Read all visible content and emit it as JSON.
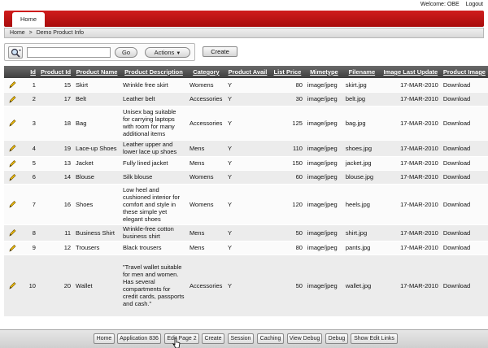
{
  "header": {
    "welcome": "Welcome: OBE",
    "logout": "Logout"
  },
  "tabs": [
    {
      "label": "Home"
    }
  ],
  "breadcrumb": {
    "home": "Home",
    "separator": ">",
    "current": "Demo Product Info"
  },
  "search": {
    "value": "",
    "go_label": "Go",
    "actions_label": "Actions",
    "actions_icon": "caret-down-icon"
  },
  "create_label": "Create",
  "table": {
    "columns": [
      "",
      "Id",
      "Product Id",
      "Product Name",
      "Product Description",
      "Category",
      "Product Avail",
      "List Price",
      "Mimetype",
      "Filename",
      "Image Last Update",
      "Product Image"
    ],
    "rows": [
      {
        "id": "1",
        "product_id": "15",
        "name": "Skirt",
        "description": "Wrinkle free skirt",
        "category": "Womens",
        "avail": "Y",
        "price": "80",
        "mimetype": "image/jpeg",
        "filename": "skirt.jpg",
        "updated": "17-MAR-2010",
        "image": "Download"
      },
      {
        "id": "2",
        "product_id": "17",
        "name": "Belt",
        "description": "Leather belt",
        "category": "Accessories",
        "avail": "Y",
        "price": "30",
        "mimetype": "image/jpeg",
        "filename": "belt.jpg",
        "updated": "17-MAR-2010",
        "image": "Download"
      },
      {
        "id": "3",
        "product_id": "18",
        "name": "Bag",
        "description": "Unisex bag suitable for carrying laptops with room for many additional items",
        "category": "Accessories",
        "avail": "Y",
        "price": "125",
        "mimetype": "image/jpeg",
        "filename": "bag.jpg",
        "updated": "17-MAR-2010",
        "image": "Download"
      },
      {
        "id": "4",
        "product_id": "19",
        "name": "Lace-up Shoes",
        "description": "Leather upper and lower lace up shoes",
        "category": "Mens",
        "avail": "Y",
        "price": "110",
        "mimetype": "image/jpeg",
        "filename": "shoes.jpg",
        "updated": "17-MAR-2010",
        "image": "Download"
      },
      {
        "id": "5",
        "product_id": "13",
        "name": "Jacket",
        "description": "Fully lined jacket",
        "category": "Mens",
        "avail": "Y",
        "price": "150",
        "mimetype": "image/jpeg",
        "filename": "jacket.jpg",
        "updated": "17-MAR-2010",
        "image": "Download"
      },
      {
        "id": "6",
        "product_id": "14",
        "name": "Blouse",
        "description": "Silk blouse",
        "category": "Womens",
        "avail": "Y",
        "price": "60",
        "mimetype": "image/jpeg",
        "filename": "blouse.jpg",
        "updated": "17-MAR-2010",
        "image": "Download"
      },
      {
        "id": "7",
        "product_id": "16",
        "name": "Shoes",
        "description": "Low heel and cushioned interior for comfort and style in these simple yet elegant shoes",
        "category": "Womens",
        "avail": "Y",
        "price": "120",
        "mimetype": "image/jpeg",
        "filename": "heels.jpg",
        "updated": "17-MAR-2010",
        "image": "Download"
      },
      {
        "id": "8",
        "product_id": "11",
        "name": "Business Shirt",
        "description": "Wrinkle-free cotton business shirt",
        "category": "Mens",
        "avail": "Y",
        "price": "50",
        "mimetype": "image/jpeg",
        "filename": "shirt.jpg",
        "updated": "17-MAR-2010",
        "image": "Download"
      },
      {
        "id": "9",
        "product_id": "12",
        "name": "Trousers",
        "description": "Black trousers",
        "category": "Mens",
        "avail": "Y",
        "price": "80",
        "mimetype": "image/jpeg",
        "filename": "pants.jpg",
        "updated": "17-MAR-2010",
        "image": "Download"
      },
      {
        "id": "10",
        "product_id": "20",
        "name": "Wallet",
        "description": "\"Travel wallet suitable for men and women. Has several compartments for credit cards, passports and cash.\"",
        "category": "Accessories",
        "avail": "Y",
        "price": "50",
        "mimetype": "image/jpeg",
        "filename": "wallet.jpg",
        "updated": "17-MAR-2010",
        "image": "Download"
      }
    ]
  },
  "devbar": {
    "home": "Home",
    "application": "Application 836",
    "edit_page": "Edit Page 2",
    "create": "Create",
    "session": "Session",
    "caching": "Caching",
    "view_debug": "View Debug",
    "debug": "Debug",
    "show_edit_links": "Show Edit Links"
  },
  "colors": {
    "brand_red": "#c41414",
    "header_gray": "#555555"
  }
}
